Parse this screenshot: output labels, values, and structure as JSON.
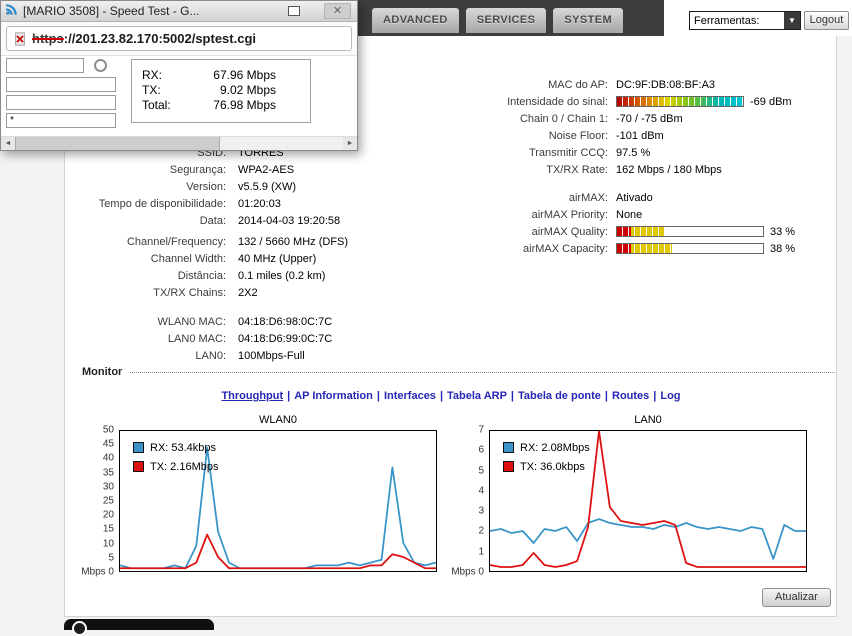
{
  "icons": {
    "close": "✕",
    "dropdown": "▼",
    "scroll_left": "◄",
    "scroll_right": "►"
  },
  "header": {
    "tabs": [
      "ADVANCED",
      "SERVICES",
      "SYSTEM"
    ],
    "tools_label": "Ferramentas:",
    "logout_label": "Logout"
  },
  "popup": {
    "title": "[MARIO 3508] - Speed Test - G...",
    "address": {
      "scheme": "https",
      "rest": "://201.23.82.170:5002/sptest.cgi"
    },
    "password_value": "*",
    "results": [
      {
        "label": "RX:",
        "value": "67.96 Mbps"
      },
      {
        "label": "TX:",
        "value": "9.02 Mbps"
      },
      {
        "label": "Total:",
        "value": "76.98 Mbps"
      }
    ]
  },
  "status": {
    "left": [
      {
        "label": "SSID:",
        "value": "TORRES"
      },
      {
        "label": "Segurança:",
        "value": "WPA2-AES"
      },
      {
        "label": "Version:",
        "value": "v5.5.9 (XW)"
      },
      {
        "label": "Tempo de disponibilidade:",
        "value": "01:20:03"
      },
      {
        "label": "Data:",
        "value": "2014-04-03 19:20:58"
      },
      {
        "label": "Channel/Frequency:",
        "value": "132 / 5660 MHz (DFS)",
        "gap": 4
      },
      {
        "label": "Channel Width:",
        "value": "40 MHz (Upper)"
      },
      {
        "label": "Distância:",
        "value": "0.1 miles (0.2 km)"
      },
      {
        "label": "TX/RX Chains:",
        "value": "2X2"
      },
      {
        "label": "WLAN0 MAC:",
        "value": "04:18:D6:98:0C:7C",
        "gap": 12
      },
      {
        "label": "LAN0 MAC:",
        "value": "04:18:D6:99:0C:7C"
      },
      {
        "label": "LAN0:",
        "value": "100Mbps-Full"
      }
    ],
    "right": [
      {
        "label": "MAC do AP:",
        "value": "DC:9F:DB:08:BF:A3"
      },
      {
        "label": "Intensidade do sinal:",
        "value": "-69 dBm",
        "bar": {
          "style": "signal",
          "name": "signal-strength-bar",
          "percent": 100
        }
      },
      {
        "label": "Chain 0 / Chain 1:",
        "value": "-70 / -75 dBm"
      },
      {
        "label": "Noise Floor:",
        "value": "-101 dBm"
      },
      {
        "label": "Transmitir CCQ:",
        "value": "97.5 %"
      },
      {
        "label": "TX/RX Rate:",
        "value": "162 Mbps / 180 Mbps"
      },
      {
        "label": "airMAX:",
        "value": "Ativado",
        "gap": 11
      },
      {
        "label": "airMAX Priority:",
        "value": "None"
      },
      {
        "label": "airMAX Quality:",
        "value": "33 %",
        "bar": {
          "style": "meter",
          "name": "airmax-quality-bar",
          "percent": 33
        }
      },
      {
        "label": "airMAX Capacity:",
        "value": "38 %",
        "bar": {
          "style": "meter",
          "name": "airmax-capacity-bar",
          "percent": 38
        }
      }
    ]
  },
  "monitor": {
    "title": "Monitor",
    "links": [
      {
        "label": "Throughput",
        "active": true
      },
      {
        "label": "AP Information"
      },
      {
        "label": "Interfaces"
      },
      {
        "label": "Tabela ARP"
      },
      {
        "label": "Tabela de ponte"
      },
      {
        "label": "Routes"
      },
      {
        "label": "Log"
      }
    ],
    "refresh_label": "Atualizar"
  },
  "chart_data": [
    {
      "type": "line",
      "title": "WLAN0",
      "ylim": [
        0,
        50
      ],
      "yticks": [
        50,
        45,
        40,
        35,
        30,
        25,
        20,
        15,
        10,
        5
      ],
      "y0_label": "Mbps 0",
      "grid": false,
      "legend_position": "top-left",
      "series": [
        {
          "name": "RX: 53.4kbps",
          "color": "#3a94c8",
          "values": [
            2,
            1,
            1,
            1,
            1,
            2,
            1,
            9,
            44,
            14,
            3,
            1,
            1,
            1,
            1,
            1,
            1,
            1,
            2,
            2,
            2,
            3,
            2,
            3,
            4,
            37,
            10,
            3,
            2,
            3
          ]
        },
        {
          "name": "TX: 2.16Mbps",
          "color": "#dd1111",
          "values": [
            1,
            1,
            1,
            1,
            1,
            1,
            1,
            3,
            13,
            5,
            1,
            1,
            1,
            1,
            1,
            1,
            1,
            1,
            1,
            1,
            1,
            1,
            1,
            2,
            2,
            6,
            5,
            3,
            1,
            1
          ]
        }
      ]
    },
    {
      "type": "line",
      "title": "LAN0",
      "ylim": [
        0,
        7
      ],
      "yticks": [
        7,
        6,
        5,
        4,
        3,
        2,
        1
      ],
      "y0_label": "Mbps 0",
      "grid": false,
      "legend_position": "top-left",
      "series": [
        {
          "name": "RX: 2.08Mbps",
          "color": "#3a94c8",
          "values": [
            2.0,
            2.1,
            1.9,
            2.0,
            1.4,
            2.1,
            2.0,
            2.2,
            1.5,
            2.4,
            2.6,
            2.4,
            2.3,
            2.2,
            2.2,
            2.1,
            2.3,
            2.2,
            2.4,
            2.2,
            2.1,
            2.2,
            2.1,
            2.0,
            2.2,
            2.1,
            0.6,
            2.3,
            2.0,
            2.0
          ]
        },
        {
          "name": "TX: 36.0kbps",
          "color": "#dd1111",
          "values": [
            0.3,
            0.2,
            0.2,
            0.3,
            0.9,
            0.3,
            0.2,
            0.3,
            0.5,
            2.2,
            7.0,
            3.2,
            2.5,
            2.4,
            2.3,
            2.4,
            2.5,
            2.3,
            0.4,
            0.2,
            0.2,
            0.2,
            0.2,
            0.2,
            0.2,
            0.2,
            0.2,
            0.2,
            0.2,
            0.2
          ]
        }
      ]
    }
  ]
}
